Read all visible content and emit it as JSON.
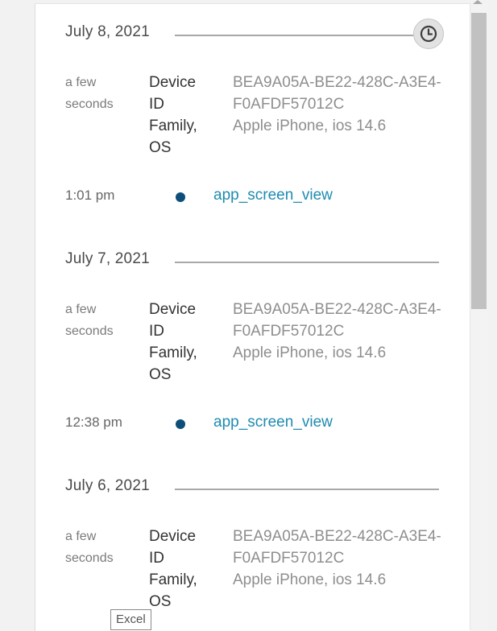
{
  "timeline": {
    "days": [
      {
        "date": "July 8, 2021",
        "session": {
          "ago_line1": "a few",
          "ago_line2": "seconds",
          "label_line1": "Device",
          "label_line2": "ID",
          "label_line3": "Family,",
          "label_line4": "OS",
          "device_id_line1": "BEA9A05A-BE22-428C-A3E4-",
          "device_id_line2": "F0AFDF57012C",
          "family_os": "Apple iPhone, ios 14.6"
        },
        "event": {
          "time": "1:01 pm",
          "name": "app_screen_view"
        }
      },
      {
        "date": "July 7, 2021",
        "session": {
          "ago_line1": "a few",
          "ago_line2": "seconds",
          "label_line1": "Device",
          "label_line2": "ID",
          "label_line3": "Family,",
          "label_line4": "OS",
          "device_id_line1": "BEA9A05A-BE22-428C-A3E4-",
          "device_id_line2": "F0AFDF57012C",
          "family_os": "Apple iPhone, ios 14.6"
        },
        "event": {
          "time": "12:38 pm",
          "name": "app_screen_view"
        }
      },
      {
        "date": "July 6, 2021",
        "session": {
          "ago_line1": "a few",
          "ago_line2": "seconds",
          "label_line1": "Device",
          "label_line2": "ID",
          "label_line3": "Family,",
          "label_line4": "OS",
          "device_id_line1": "BEA9A05A-BE22-428C-A3E4-",
          "device_id_line2": "F0AFDF57012C",
          "family_os": "Apple iPhone, ios 14.6"
        }
      }
    ]
  },
  "tooltip": {
    "text": "Excel"
  },
  "icons": {
    "clock": "clock-icon"
  },
  "colors": {
    "event_dot": "#0d4f7a",
    "event_link": "#1f8bb0",
    "panel_bg": "#ffffff",
    "page_bg": "#f2f2f2"
  }
}
